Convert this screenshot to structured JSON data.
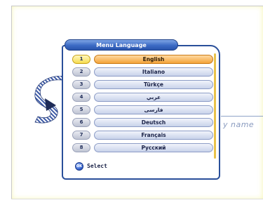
{
  "menu": {
    "title": "Menu Language",
    "selected_index": 0,
    "items": [
      {
        "number": "1",
        "label": "English"
      },
      {
        "number": "2",
        "label": "Italiano"
      },
      {
        "number": "3",
        "label": "Türkçe"
      },
      {
        "number": "4",
        "label": "عربي"
      },
      {
        "number": "5",
        "label": "فارسی"
      },
      {
        "number": "6",
        "label": "Deutsch"
      },
      {
        "number": "7",
        "label": "Français"
      },
      {
        "number": "8",
        "label": "Русский"
      }
    ]
  },
  "footer": {
    "ok_icon_text": "OK",
    "ok_label": "Select"
  },
  "background": {
    "tagline_fragment": "y name"
  },
  "colors": {
    "panel_border": "#2a4f9a",
    "title_bar": "#3c6ac4",
    "selected_row": "#f4a43a",
    "selected_number": "#f6dc4f",
    "scrollbar": "#e8c24a"
  },
  "icons": {
    "logo": "striped-s-logo-icon",
    "ok_button": "ok-button-icon"
  }
}
